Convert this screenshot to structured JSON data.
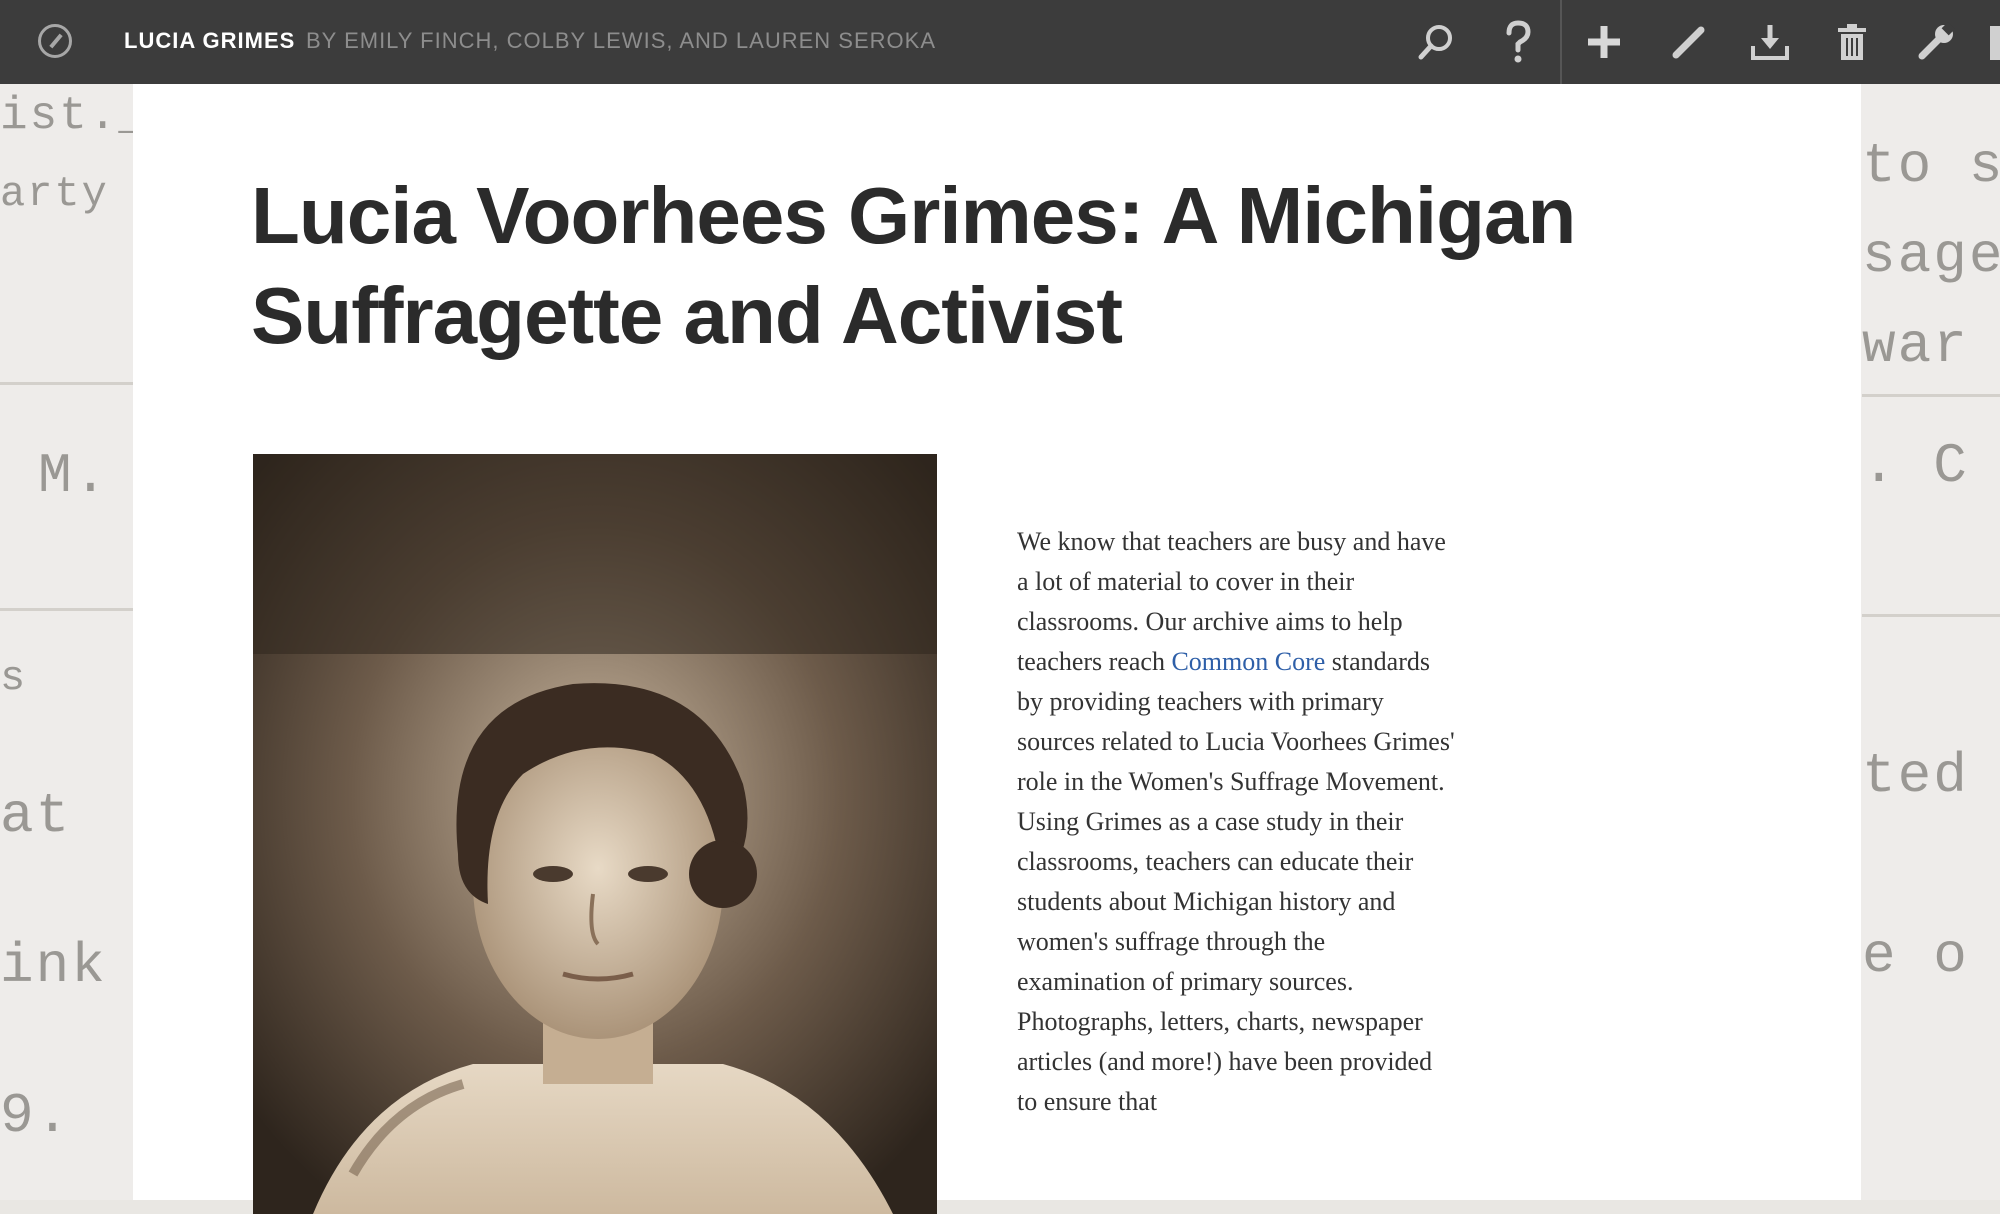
{
  "toolbar": {
    "book_title": "LUCIA GRIMES",
    "byline": "BY EMILY FINCH, COLBY LEWIS, AND LAUREN SEROKA",
    "icons": [
      "compass-icon",
      "search-icon",
      "help-icon",
      "add-icon",
      "edit-icon",
      "download-icon",
      "trash-icon",
      "wrench-icon"
    ]
  },
  "background_fragments": {
    "left": [
      "ist.__",
      "arty",
      "M.",
      "s",
      "at",
      "ink",
      "9."
    ],
    "right": [
      "to s",
      "sage",
      "war",
      ". C",
      "ted",
      "e o"
    ]
  },
  "page": {
    "title": "Lucia Voorhees Grimes: A Michigan Suffragette and Activist",
    "body_before_link": "We know that teachers are busy and have a lot of material to cover in their classrooms. Our archive aims to help teachers reach ",
    "link_text": "Common Core",
    "body_after_link": " standards by providing teachers with primary sources related to Lucia Voorhees Grimes' role in the Women's Suffrage Movement. Using Grimes as a case study in their classrooms, teachers can educate their students about Michigan history and women's suffrage through the examination of primary sources. Photographs, letters, charts, newspaper articles (and more!) have been provided to ensure that"
  },
  "colors": {
    "toolbar_bg": "#3c3c3c",
    "link": "#2e5fa8",
    "title": "#2b2b2b"
  }
}
